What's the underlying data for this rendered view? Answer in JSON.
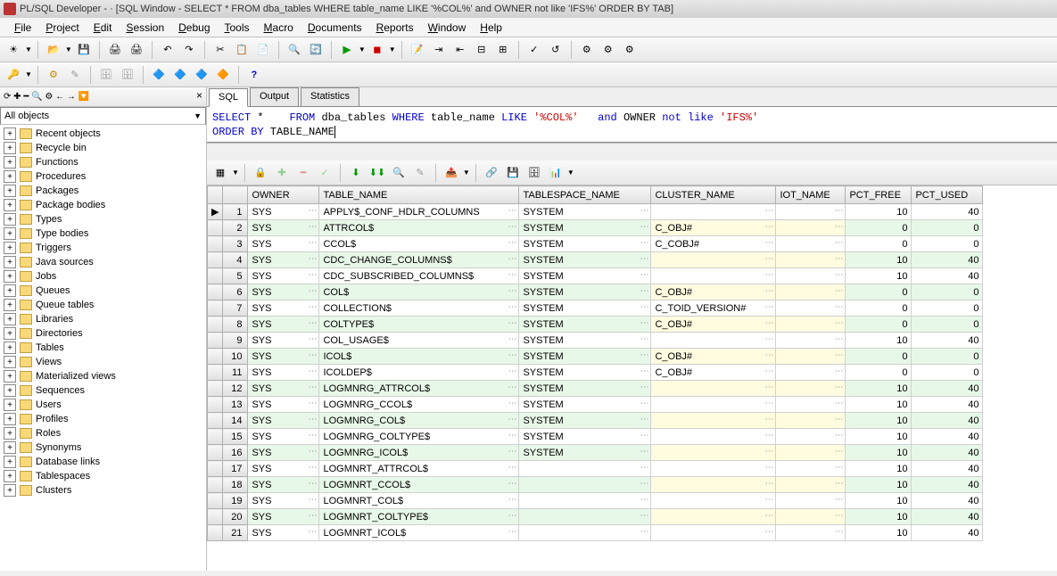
{
  "title": "PL/SQL Developer -                                                    · [SQL Window - SELECT * FROM dba_tables WHERE table_name LIKE '%COL%' and OWNER not like 'IFS%' ORDER BY TAB]",
  "menu": [
    "File",
    "Project",
    "Edit",
    "Session",
    "Debug",
    "Tools",
    "Macro",
    "Documents",
    "Reports",
    "Window",
    "Help"
  ],
  "sidebar": {
    "filter": "All objects",
    "items": [
      "Recent objects",
      "Recycle bin",
      "Functions",
      "Procedures",
      "Packages",
      "Package bodies",
      "Types",
      "Type bodies",
      "Triggers",
      "Java sources",
      "Jobs",
      "Queues",
      "Queue tables",
      "Libraries",
      "Directories",
      "Tables",
      "Views",
      "Materialized views",
      "Sequences",
      "Users",
      "Profiles",
      "Roles",
      "Synonyms",
      "Database links",
      "Tablespaces",
      "Clusters"
    ]
  },
  "tabs": {
    "sql": "SQL",
    "output": "Output",
    "stats": "Statistics"
  },
  "sql": {
    "line1_parts": [
      "SELECT",
      " *    ",
      "FROM",
      " dba_tables ",
      "WHERE",
      " table_name ",
      "LIKE",
      " ",
      "'%COL%'",
      "   ",
      "and",
      " OWNER ",
      "not like",
      " ",
      "'IFS%'"
    ],
    "line2_parts": [
      "ORDER BY",
      " TABLE_NAME"
    ]
  },
  "grid": {
    "columns": [
      "",
      "OWNER",
      "TABLE_NAME",
      "TABLESPACE_NAME",
      "CLUSTER_NAME",
      "IOT_NAME",
      "PCT_FREE",
      "PCT_USED"
    ],
    "rows": [
      {
        "n": 1,
        "mark": "▶",
        "owner": "SYS",
        "tname": "APPLY$_CONF_HDLR_COLUMNS",
        "ts": "SYSTEM",
        "cluster": "",
        "iot": "",
        "pf": "10",
        "pu": "40"
      },
      {
        "n": 2,
        "owner": "SYS",
        "tname": "ATTRCOL$",
        "ts": "SYSTEM",
        "cluster": "C_OBJ#",
        "iot": "",
        "pf": "0",
        "pu": "0"
      },
      {
        "n": 3,
        "owner": "SYS",
        "tname": "CCOL$",
        "ts": "SYSTEM",
        "cluster": "C_COBJ#",
        "iot": "",
        "pf": "0",
        "pu": "0"
      },
      {
        "n": 4,
        "owner": "SYS",
        "tname": "CDC_CHANGE_COLUMNS$",
        "ts": "SYSTEM",
        "cluster": "",
        "iot": "",
        "pf": "10",
        "pu": "40"
      },
      {
        "n": 5,
        "owner": "SYS",
        "tname": "CDC_SUBSCRIBED_COLUMNS$",
        "ts": "SYSTEM",
        "cluster": "",
        "iot": "",
        "pf": "10",
        "pu": "40"
      },
      {
        "n": 6,
        "owner": "SYS",
        "tname": "COL$",
        "ts": "SYSTEM",
        "cluster": "C_OBJ#",
        "iot": "",
        "pf": "0",
        "pu": "0"
      },
      {
        "n": 7,
        "owner": "SYS",
        "tname": "COLLECTION$",
        "ts": "SYSTEM",
        "cluster": "C_TOID_VERSION#",
        "iot": "",
        "pf": "0",
        "pu": "0"
      },
      {
        "n": 8,
        "owner": "SYS",
        "tname": "COLTYPE$",
        "ts": "SYSTEM",
        "cluster": "C_OBJ#",
        "iot": "",
        "pf": "0",
        "pu": "0"
      },
      {
        "n": 9,
        "owner": "SYS",
        "tname": "COL_USAGE$",
        "ts": "SYSTEM",
        "cluster": "",
        "iot": "",
        "pf": "10",
        "pu": "40"
      },
      {
        "n": 10,
        "owner": "SYS",
        "tname": "ICOL$",
        "ts": "SYSTEM",
        "cluster": "C_OBJ#",
        "iot": "",
        "pf": "0",
        "pu": "0"
      },
      {
        "n": 11,
        "owner": "SYS",
        "tname": "ICOLDEP$",
        "ts": "SYSTEM",
        "cluster": "C_OBJ#",
        "iot": "",
        "pf": "0",
        "pu": "0"
      },
      {
        "n": 12,
        "owner": "SYS",
        "tname": "LOGMNRG_ATTRCOL$",
        "ts": "SYSTEM",
        "cluster": "",
        "iot": "",
        "pf": "10",
        "pu": "40"
      },
      {
        "n": 13,
        "owner": "SYS",
        "tname": "LOGMNRG_CCOL$",
        "ts": "SYSTEM",
        "cluster": "",
        "iot": "",
        "pf": "10",
        "pu": "40"
      },
      {
        "n": 14,
        "owner": "SYS",
        "tname": "LOGMNRG_COL$",
        "ts": "SYSTEM",
        "cluster": "",
        "iot": "",
        "pf": "10",
        "pu": "40"
      },
      {
        "n": 15,
        "owner": "SYS",
        "tname": "LOGMNRG_COLTYPE$",
        "ts": "SYSTEM",
        "cluster": "",
        "iot": "",
        "pf": "10",
        "pu": "40"
      },
      {
        "n": 16,
        "owner": "SYS",
        "tname": "LOGMNRG_ICOL$",
        "ts": "SYSTEM",
        "cluster": "",
        "iot": "",
        "pf": "10",
        "pu": "40"
      },
      {
        "n": 17,
        "owner": "SYS",
        "tname": "LOGMNRT_ATTRCOL$",
        "ts": "",
        "cluster": "",
        "iot": "",
        "pf": "10",
        "pu": "40"
      },
      {
        "n": 18,
        "owner": "SYS",
        "tname": "LOGMNRT_CCOL$",
        "ts": "",
        "cluster": "",
        "iot": "",
        "pf": "10",
        "pu": "40"
      },
      {
        "n": 19,
        "owner": "SYS",
        "tname": "LOGMNRT_COL$",
        "ts": "",
        "cluster": "",
        "iot": "",
        "pf": "10",
        "pu": "40"
      },
      {
        "n": 20,
        "owner": "SYS",
        "tname": "LOGMNRT_COLTYPE$",
        "ts": "",
        "cluster": "",
        "iot": "",
        "pf": "10",
        "pu": "40"
      },
      {
        "n": 21,
        "owner": "SYS",
        "tname": "LOGMNRT_ICOL$",
        "ts": "",
        "cluster": "",
        "iot": "",
        "pf": "10",
        "pu": "40"
      }
    ]
  }
}
